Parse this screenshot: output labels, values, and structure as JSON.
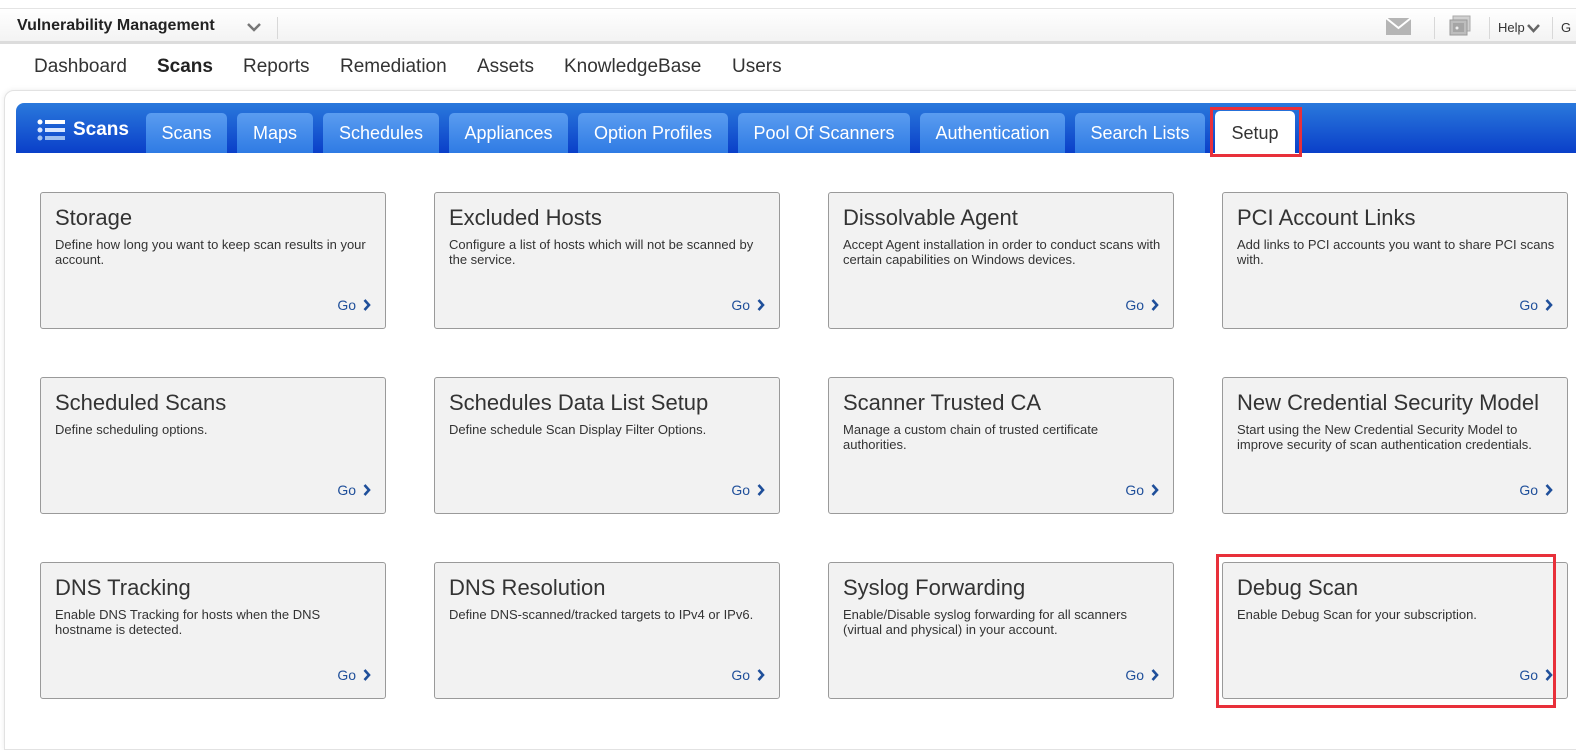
{
  "topbar": {
    "app_title": "Vulnerability Management",
    "help_label": "Help",
    "user_initial": "G",
    "icons": [
      "chevron-down-icon",
      "mail-icon",
      "photo-icon",
      "chevron-down-icon"
    ]
  },
  "mainnav": {
    "items": [
      {
        "label": "Dashboard",
        "active": false
      },
      {
        "label": "Scans",
        "active": true
      },
      {
        "label": "Reports",
        "active": false
      },
      {
        "label": "Remediation",
        "active": false
      },
      {
        "label": "Assets",
        "active": false
      },
      {
        "label": "KnowledgeBase",
        "active": false
      },
      {
        "label": "Users",
        "active": false
      }
    ]
  },
  "section": {
    "label": "Scans",
    "icon": "list-icon"
  },
  "tabs": [
    {
      "label": "Scans",
      "active": false
    },
    {
      "label": "Maps",
      "active": false
    },
    {
      "label": "Schedules",
      "active": false
    },
    {
      "label": "Appliances",
      "active": false
    },
    {
      "label": "Option Profiles",
      "active": false
    },
    {
      "label": "Pool Of Scanners",
      "active": false
    },
    {
      "label": "Authentication",
      "active": false
    },
    {
      "label": "Search Lists",
      "active": false
    },
    {
      "label": "Setup",
      "active": true
    }
  ],
  "cards": [
    {
      "title": "Storage",
      "desc": "Define how long you want to keep scan results in your account.",
      "go": "Go"
    },
    {
      "title": "Excluded Hosts",
      "desc": "Configure a list of hosts which will not be scanned by the service.",
      "go": "Go"
    },
    {
      "title": "Dissolvable Agent",
      "desc": "Accept Agent installation in order to conduct scans with certain capabilities on Windows devices.",
      "go": "Go"
    },
    {
      "title": "PCI Account Links",
      "desc": "Add links to PCI accounts you want to share PCI scans with.",
      "go": "Go"
    },
    {
      "title": "Scheduled Scans",
      "desc": "Define scheduling options.",
      "go": "Go"
    },
    {
      "title": "Schedules Data List Setup",
      "desc": "Define schedule Scan Display Filter Options.",
      "go": "Go"
    },
    {
      "title": "Scanner Trusted CA",
      "desc": "Manage a custom chain of trusted certificate authorities.",
      "go": "Go"
    },
    {
      "title": "New Credential Security Model",
      "desc": "Start using the New Credential Security Model to improve security of scan authentication credentials.",
      "go": "Go"
    },
    {
      "title": "DNS Tracking",
      "desc": "Enable DNS Tracking for hosts when the DNS hostname is detected.",
      "go": "Go"
    },
    {
      "title": "DNS Resolution",
      "desc": "Define DNS-scanned/tracked targets to IPv4 or IPv6.",
      "go": "Go"
    },
    {
      "title": "Syslog Forwarding",
      "desc": "Enable/Disable syslog forwarding for all scanners (virtual and physical) in your account.",
      "go": "Go"
    },
    {
      "title": "Debug Scan",
      "desc": "Enable Debug Scan for your subscription.",
      "go": "Go"
    }
  ],
  "colors": {
    "tabbar_top": "#2a79dc",
    "tabbar_bottom": "#0a3fc9",
    "link": "#1f4f9a",
    "highlight": "#e8303a",
    "card_bg": "#f2f2f2"
  }
}
